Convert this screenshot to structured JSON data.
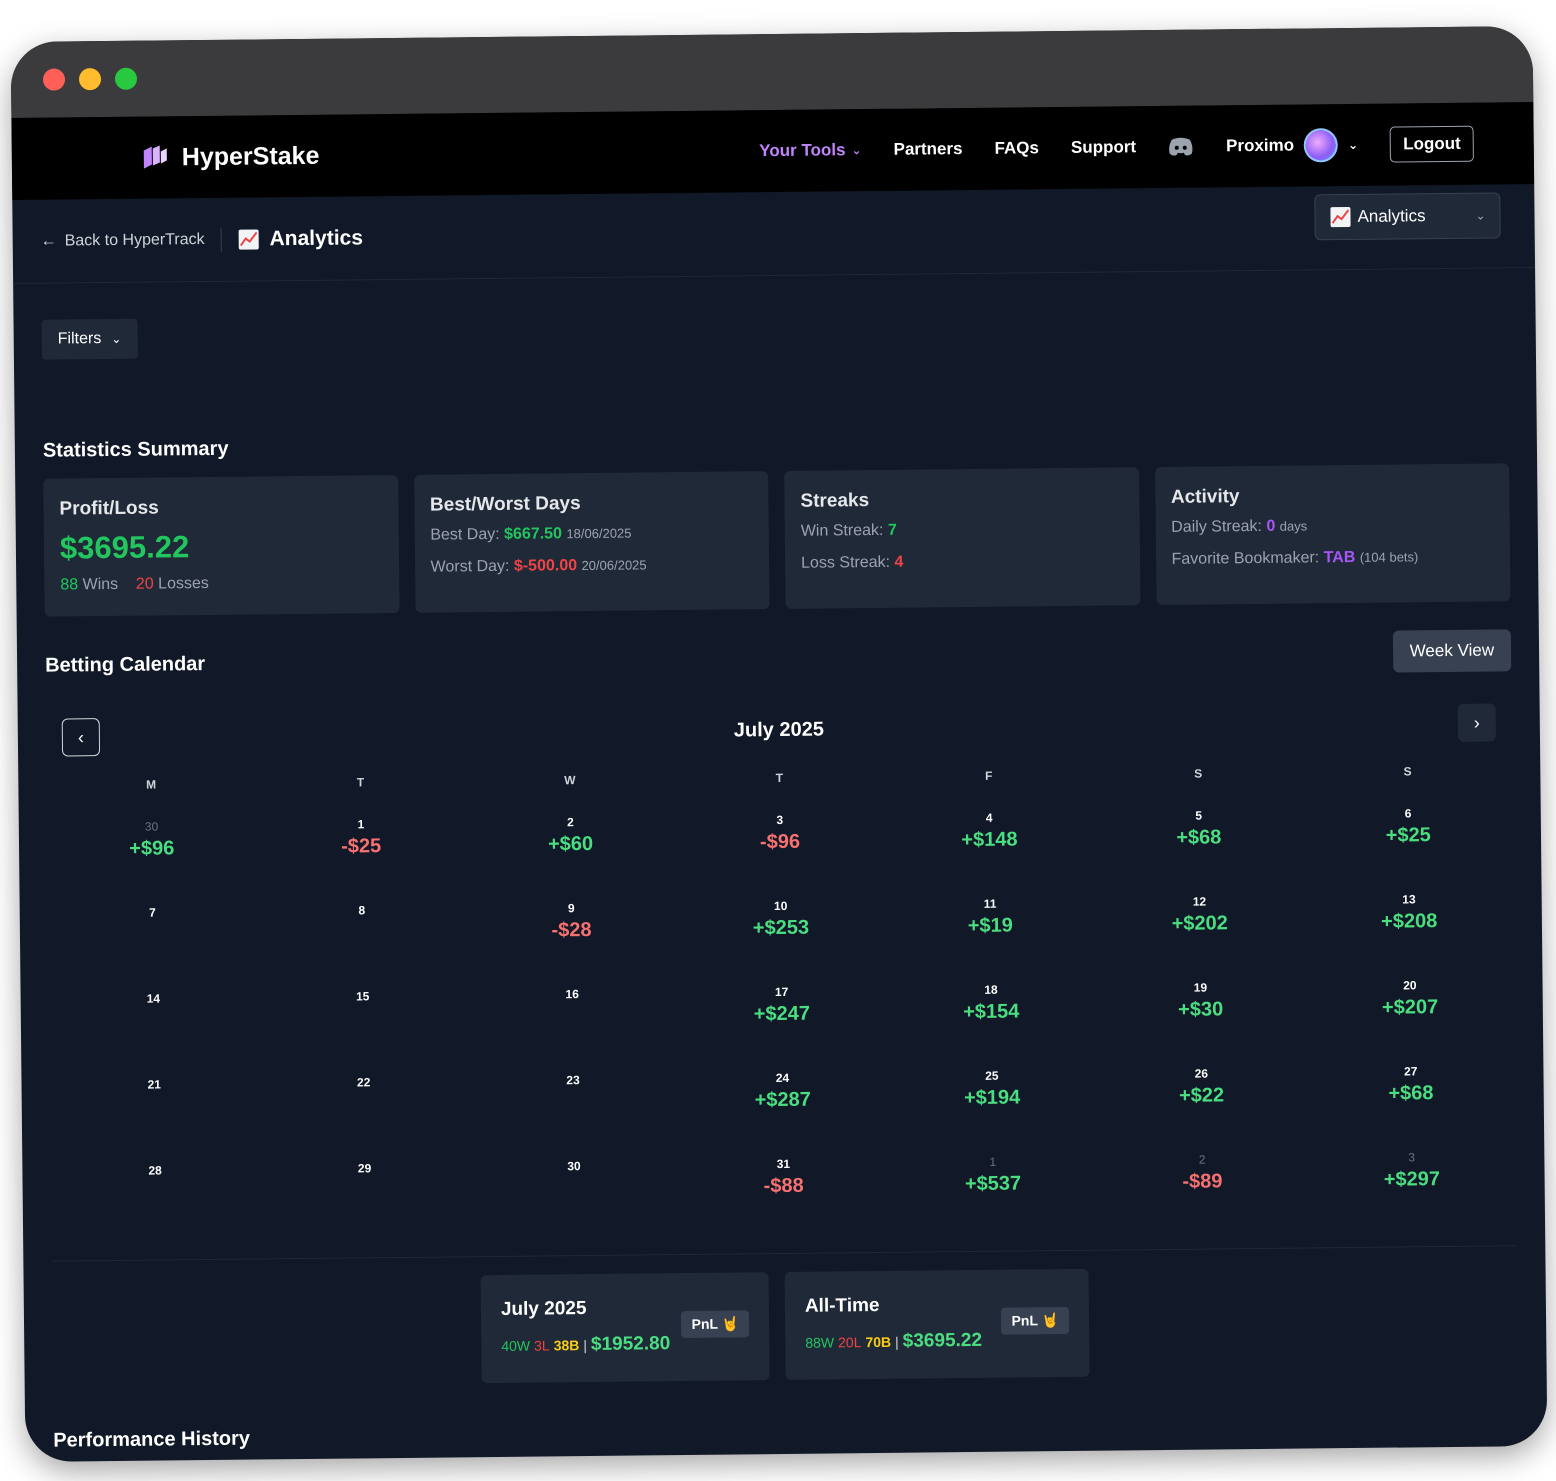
{
  "nav": {
    "brand": "HyperStake",
    "links": [
      {
        "label": "Your Tools",
        "active": true
      },
      {
        "label": "Partners"
      },
      {
        "label": "FAQs"
      },
      {
        "label": "Support"
      }
    ],
    "username": "Proximo",
    "logout": "Logout"
  },
  "subheader": {
    "back": "Back to HyperTrack",
    "title": "Analytics",
    "view_select": "Analytics"
  },
  "filters_label": "Filters",
  "stats": {
    "title": "Statistics Summary",
    "profit": {
      "title": "Profit/Loss",
      "amount": "$3695.22",
      "wins": "88",
      "wins_label": "Wins",
      "losses": "20",
      "losses_label": "Losses"
    },
    "days": {
      "title": "Best/Worst Days",
      "best_label": "Best Day:",
      "best_value": "$667.50",
      "best_date": "18/06/2025",
      "worst_label": "Worst Day:",
      "worst_value": "$-500.00",
      "worst_date": "20/06/2025"
    },
    "streaks": {
      "title": "Streaks",
      "win_label": "Win Streak:",
      "win_value": "7",
      "loss_label": "Loss Streak:",
      "loss_value": "4"
    },
    "activity": {
      "title": "Activity",
      "daily_label": "Daily Streak:",
      "daily_value": "0",
      "daily_unit": "days",
      "bookie_label": "Favorite Bookmaker:",
      "bookie_value": "TAB",
      "bookie_count": "(104 bets)"
    }
  },
  "calendar": {
    "title": "Betting Calendar",
    "week_view": "Week View",
    "month": "July 2025",
    "weekdays": [
      "M",
      "T",
      "W",
      "T",
      "F",
      "S",
      "S"
    ],
    "days": [
      {
        "n": "30",
        "v": "+$96",
        "muted": true
      },
      {
        "n": "1",
        "v": "-$25"
      },
      {
        "n": "2",
        "v": "+$60"
      },
      {
        "n": "3",
        "v": "-$96"
      },
      {
        "n": "4",
        "v": "+$148"
      },
      {
        "n": "5",
        "v": "+$68"
      },
      {
        "n": "6",
        "v": "+$25"
      },
      {
        "n": "7",
        "v": ""
      },
      {
        "n": "8",
        "v": ""
      },
      {
        "n": "9",
        "v": "-$28"
      },
      {
        "n": "10",
        "v": "+$253"
      },
      {
        "n": "11",
        "v": "+$19"
      },
      {
        "n": "12",
        "v": "+$202"
      },
      {
        "n": "13",
        "v": "+$208"
      },
      {
        "n": "14",
        "v": ""
      },
      {
        "n": "15",
        "v": ""
      },
      {
        "n": "16",
        "v": ""
      },
      {
        "n": "17",
        "v": "+$247"
      },
      {
        "n": "18",
        "v": "+$154"
      },
      {
        "n": "19",
        "v": "+$30"
      },
      {
        "n": "20",
        "v": "+$207"
      },
      {
        "n": "21",
        "v": ""
      },
      {
        "n": "22",
        "v": ""
      },
      {
        "n": "23",
        "v": ""
      },
      {
        "n": "24",
        "v": "+$287"
      },
      {
        "n": "25",
        "v": "+$194"
      },
      {
        "n": "26",
        "v": "+$22"
      },
      {
        "n": "27",
        "v": "+$68"
      },
      {
        "n": "28",
        "v": ""
      },
      {
        "n": "29",
        "v": ""
      },
      {
        "n": "30",
        "v": ""
      },
      {
        "n": "31",
        "v": "-$88"
      },
      {
        "n": "1",
        "v": "+$537",
        "muted": true
      },
      {
        "n": "2",
        "v": "-$89",
        "muted": true
      },
      {
        "n": "3",
        "v": "+$297",
        "muted": true
      }
    ],
    "month_summary": {
      "title": "July 2025",
      "w": "40W",
      "l": "3L",
      "b": "38B",
      "sep": "|",
      "amount": "$1952.80",
      "badge": "PnL 🤘"
    },
    "all_time": {
      "title": "All-Time",
      "w": "88W",
      "l": "20L",
      "b": "70B",
      "sep": "|",
      "amount": "$3695.22",
      "badge": "PnL 🤘"
    }
  },
  "performance_title": "Performance History",
  "colors": {
    "positive": "#4ade80",
    "negative": "#f87171",
    "accent": "#c084fc",
    "bg": "#111827",
    "card": "#1f2937"
  }
}
